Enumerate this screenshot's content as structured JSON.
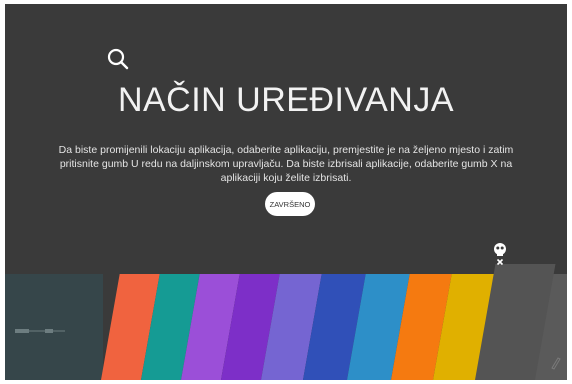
{
  "header": {
    "title": "NAČIN UREĐIVANJA",
    "description": "Da biste promijenili lokaciju aplikacija, odaberite aplikaciju, premjestite je na željeno mjesto i zatim pritisnite gumb U redu na daljinskom upravljaču. Da biste izbrisali aplikacije, odaberite gumb X na aplikaciji koju želite izbrisati."
  },
  "buttons": {
    "done_label": "ZAVRŠENO"
  },
  "colors": {
    "screen_bg": "#3a3a3a",
    "tiles": [
      "#f0633f",
      "#159b94",
      "#9b4fd8",
      "#7d2fc8",
      "#7565d2",
      "#3050b8",
      "#2d8fc8",
      "#f57a10",
      "#e0b000",
      "#505050",
      "#5a5a5a"
    ]
  },
  "icons": [
    "search-icon",
    "cable-icon",
    "delete-x-icon",
    "pencil-icon"
  ]
}
